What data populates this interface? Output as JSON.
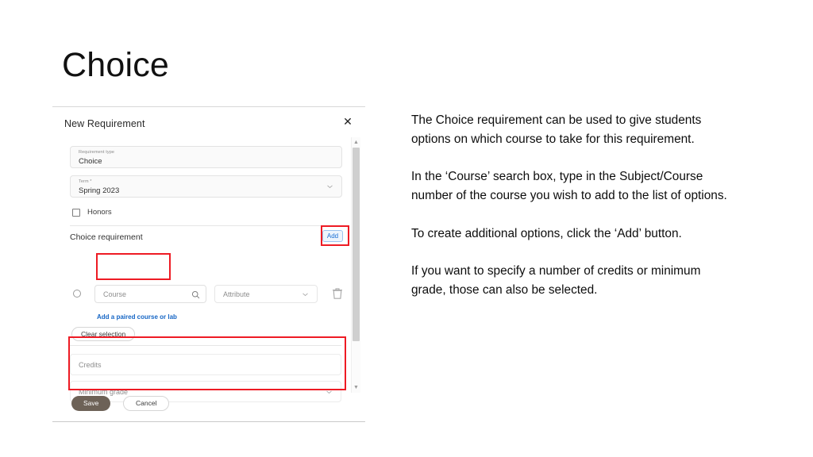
{
  "slide": {
    "title": "Choice"
  },
  "dialog": {
    "title": "New Requirement",
    "close_icon": "close-icon",
    "fields": {
      "requirement_type": {
        "label": "Requirement type",
        "value": "Choice"
      },
      "term": {
        "label": "Term *",
        "value": "Spring 2023",
        "chevron": "chevron-down-icon"
      },
      "honors": {
        "label": "Honors",
        "checked": false
      },
      "course": {
        "placeholder": "Course",
        "value": "",
        "search_icon": "search-icon"
      },
      "attribute": {
        "placeholder": "Attribute",
        "value": "",
        "chevron": "chevron-down-icon"
      },
      "credits": {
        "placeholder": "Credits",
        "value": ""
      },
      "minimum_grade": {
        "placeholder": "Minimum grade",
        "value": "",
        "chevron": "chevron-down-icon"
      }
    },
    "section": {
      "title": "Choice requirement",
      "add_label": "Add"
    },
    "links": {
      "paired_course": "Add a paired course or lab"
    },
    "buttons": {
      "clear_selection": "Clear selection",
      "save": "Save",
      "cancel": "Cancel",
      "delete_icon": "trash-icon"
    },
    "scrollbar": {
      "up_arrow": "▲",
      "down_arrow": "▼"
    }
  },
  "notes": {
    "paragraphs": [
      "The Choice requirement can be used to give students options on which course to take for this requirement.",
      "In the ‘Course’ search box, type in the Subject/Course number of the course you wish to add to the list of options.",
      "To create additional options, click the ‘Add’ button.",
      "If you want to specify a number of credits or minimum grade, those can also be selected."
    ]
  },
  "colors": {
    "highlight_red": "#ee1b24",
    "add_button_blue": "#1a6fd4",
    "link_blue": "#1666c5",
    "save_button": "#6d6257"
  }
}
